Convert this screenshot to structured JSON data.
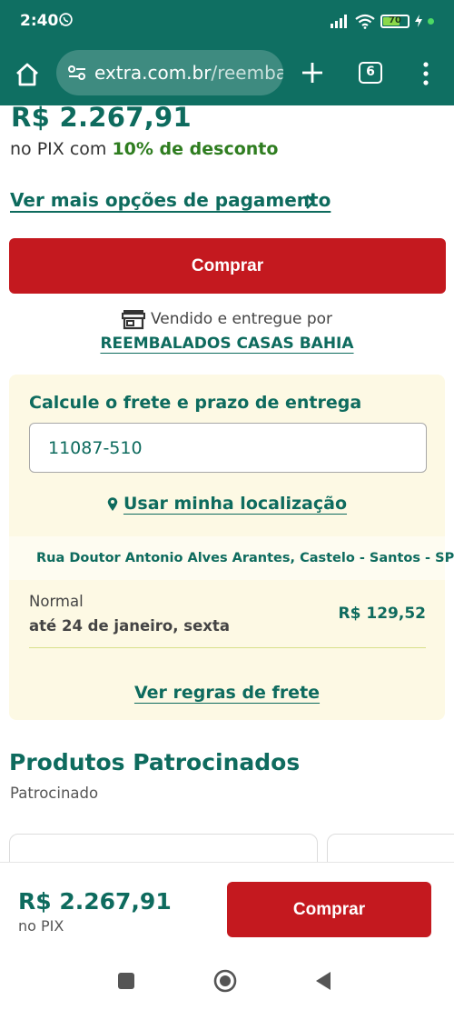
{
  "status_bar": {
    "time": "2:40",
    "battery": "70",
    "battery_level_pct": 70
  },
  "browser": {
    "url_host": "extra.com.br",
    "url_path": "/reembal",
    "tab_count": "6"
  },
  "product": {
    "price": "R$ 2.267,91",
    "pix_prefix": "no PIX com ",
    "pix_discount": "10% de desconto",
    "more_payment_link": "Ver mais opções de pagamento",
    "buy_label": "Comprar",
    "sold_by_text": "Vendido e entregue por",
    "seller_name": "REEMBALADOS CASAS BAHIA"
  },
  "freight": {
    "title": "Calcule o frete e prazo de entrega",
    "cep_value": "11087-510",
    "use_location_label": "Usar minha localização",
    "address": "Rua Doutor Antonio Alves Arantes, Castelo - Santos - SP",
    "shipping_type": "Normal",
    "shipping_date": "até 24 de janeiro, sexta",
    "shipping_price": "R$ 129,52",
    "rules_link": "Ver regras de frete"
  },
  "sponsored": {
    "title": "Produtos Patrocinados",
    "subtitle": "Patrocinado"
  },
  "footer": {
    "price": "R$ 2.267,91",
    "pix_label": "no PIX",
    "buy_label": "Comprar"
  },
  "colors": {
    "brand_green": "#0f6f62",
    "text_green": "#0e6b5e",
    "buy_red": "#c4191f",
    "discount_green": "#2f7d20",
    "freight_bg": "#fdf9e4"
  }
}
